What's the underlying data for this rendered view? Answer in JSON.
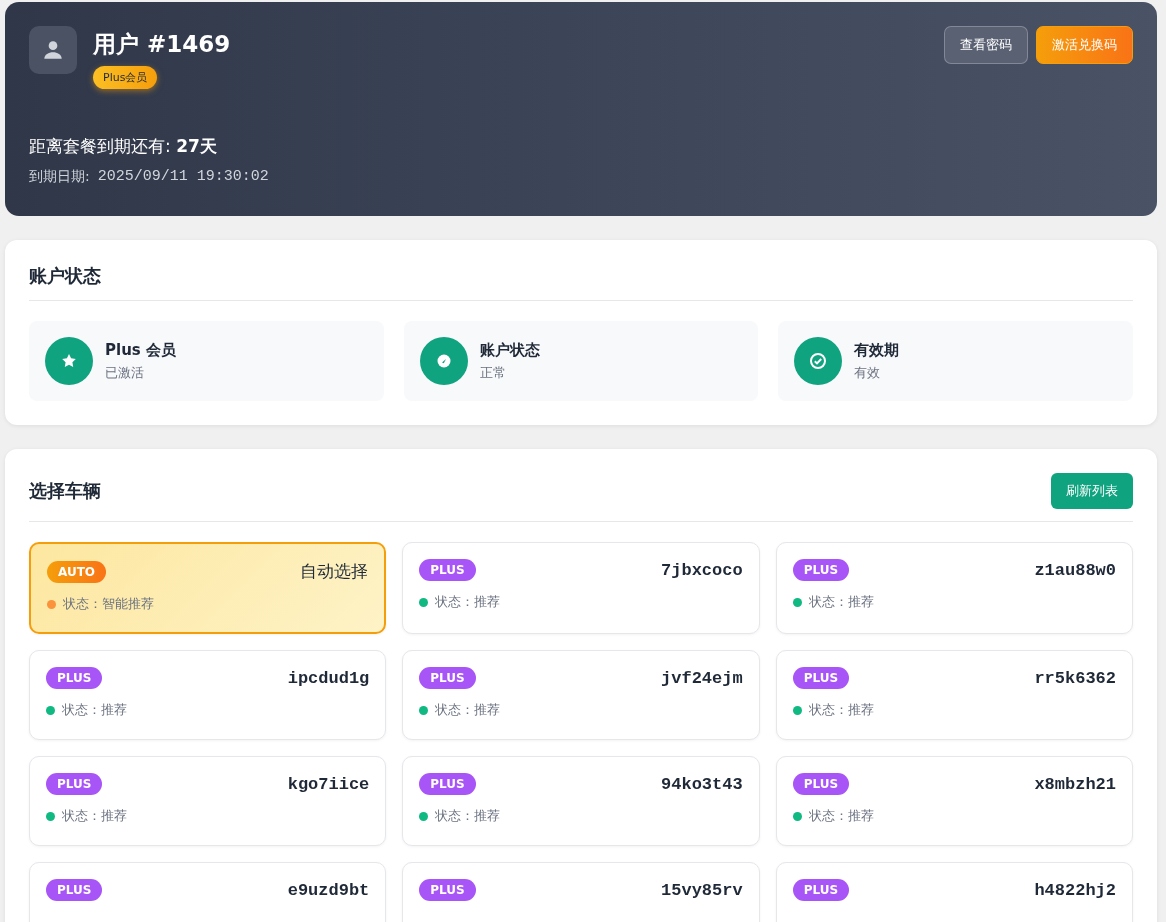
{
  "header": {
    "title": "用户 #1469",
    "badge": "Plus会员",
    "buttons": [
      {
        "label": "查看密码",
        "kind": "ghost"
      },
      {
        "label": "激活兑换码",
        "kind": "primary"
      }
    ],
    "countdown_label": "距离套餐到期还有: ",
    "countdown_value": "27天",
    "expiry_label": "到期日期:",
    "expiry_value": "2025/09/11 19:30:02"
  },
  "account": {
    "title": "账户状态",
    "items": [
      {
        "kind": "star",
        "title": "Plus 会员",
        "status": "已激活"
      },
      {
        "kind": "gauge",
        "title": "账户状态",
        "status": "正常"
      },
      {
        "kind": "check",
        "title": "有效期",
        "status": "有效"
      }
    ]
  },
  "vehicles": {
    "title": "选择车辆",
    "refresh": "刷新列表",
    "cards": [
      {
        "kind": "auto",
        "badge": "AUTO",
        "name": "自动选择",
        "status": "状态：智能推荐",
        "color": "#fb923c",
        "selected": true
      },
      {
        "kind": "plus",
        "badge": "PLUS",
        "name": "7jbxcoco",
        "status": "状态：推荐",
        "color": "#10b981",
        "selected": false
      },
      {
        "kind": "plus",
        "badge": "PLUS",
        "name": "z1au88w0",
        "status": "状态：推荐",
        "color": "#10b981",
        "selected": false
      },
      {
        "kind": "plus",
        "badge": "PLUS",
        "name": "ipcdud1g",
        "status": "状态：推荐",
        "color": "#10b981",
        "selected": false
      },
      {
        "kind": "plus",
        "badge": "PLUS",
        "name": "jvf24ejm",
        "status": "状态：推荐",
        "color": "#10b981",
        "selected": false
      },
      {
        "kind": "plus",
        "badge": "PLUS",
        "name": "rr5k6362",
        "status": "状态：推荐",
        "color": "#10b981",
        "selected": false
      },
      {
        "kind": "plus",
        "badge": "PLUS",
        "name": "kgo7iice",
        "status": "状态：推荐",
        "color": "#10b981",
        "selected": false
      },
      {
        "kind": "plus",
        "badge": "PLUS",
        "name": "94ko3t43",
        "status": "状态：推荐",
        "color": "#10b981",
        "selected": false
      },
      {
        "kind": "plus",
        "badge": "PLUS",
        "name": "x8mbzh21",
        "status": "状态：推荐",
        "color": "#10b981",
        "selected": false
      },
      {
        "kind": "plus",
        "badge": "PLUS",
        "name": "e9uzd9bt",
        "selected": false
      },
      {
        "kind": "plus",
        "badge": "PLUS",
        "name": "15vy85rv",
        "selected": false
      },
      {
        "kind": "plus",
        "badge": "PLUS",
        "name": "h4822hj2",
        "selected": false
      }
    ]
  }
}
